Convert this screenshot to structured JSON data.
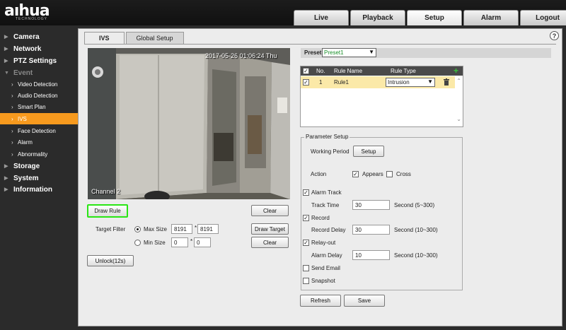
{
  "brand": {
    "name": "aıhua",
    "tagline": "TECHNOLOGY"
  },
  "topnav": [
    {
      "label": "Live"
    },
    {
      "label": "Playback"
    },
    {
      "label": "Setup",
      "active": true
    },
    {
      "label": "Alarm"
    },
    {
      "label": "Logout"
    }
  ],
  "sidebar": {
    "items": [
      {
        "label": "Camera",
        "level": "main",
        "icon": "chevron-right-icon"
      },
      {
        "label": "Network",
        "level": "main",
        "icon": "chevron-right-icon"
      },
      {
        "label": "PTZ Settings",
        "level": "main",
        "icon": "chevron-right-icon"
      },
      {
        "label": "Event",
        "level": "main",
        "icon": "chevron-down-icon",
        "open": true
      },
      {
        "label": "Video Detection",
        "level": "sub",
        "icon": "chevron-right-icon"
      },
      {
        "label": "Audio Detection",
        "level": "sub",
        "icon": "chevron-right-icon"
      },
      {
        "label": "Smart Plan",
        "level": "sub",
        "icon": "chevron-right-icon"
      },
      {
        "label": "IVS",
        "level": "sub",
        "icon": "chevron-right-icon",
        "selected": true
      },
      {
        "label": "Face Detection",
        "level": "sub",
        "icon": "chevron-right-icon"
      },
      {
        "label": "Alarm",
        "level": "sub",
        "icon": "chevron-right-icon"
      },
      {
        "label": "Abnormality",
        "level": "sub",
        "icon": "chevron-right-icon"
      },
      {
        "label": "Storage",
        "level": "main",
        "icon": "chevron-right-icon"
      },
      {
        "label": "System",
        "level": "main",
        "icon": "chevron-right-icon"
      },
      {
        "label": "Information",
        "level": "main",
        "icon": "chevron-right-icon"
      }
    ]
  },
  "content": {
    "help": "?",
    "tabs": [
      {
        "label": "IVS",
        "active": true
      },
      {
        "label": "Global Setup"
      }
    ],
    "video": {
      "timestamp": "2017-05-26 01:06:24 Thu",
      "channel": "Channel 2"
    },
    "left": {
      "draw_rule": "Draw Rule",
      "clear1": "Clear",
      "target_filter": "Target Filter",
      "max_size": "Max Size",
      "max_w": "8191",
      "max_sep": "*",
      "max_h": "8191",
      "draw_target": "Draw Target",
      "min_size": "Min Size",
      "min_w": "0",
      "min_sep": "*",
      "min_h": "0",
      "clear2": "Clear",
      "unlock": "Unlock(12s)"
    },
    "preset": {
      "label": "Preset",
      "value": "Preset1"
    },
    "rules": {
      "headers": {
        "no": "No.",
        "name": "Rule Name",
        "type": "Rule Type"
      },
      "add_icon": "plus-icon",
      "row": {
        "no": "1",
        "name": "Rule1",
        "type": "Intrusion",
        "delete_icon": "trash-icon"
      }
    },
    "params": {
      "legend": "Parameter Setup",
      "working_period": "Working Period",
      "setup": "Setup",
      "action": "Action",
      "appears": "Appears",
      "cross": "Cross",
      "alarm_track": "Alarm Track",
      "track_time": "Track Time",
      "track_time_value": "30",
      "track_time_unit": "Second (5~300)",
      "record": "Record",
      "record_delay": "Record Delay",
      "record_delay_value": "30",
      "record_delay_unit": "Second (10~300)",
      "relay_out": "Relay-out",
      "alarm_delay": "Alarm Delay",
      "alarm_delay_value": "10",
      "alarm_delay_unit": "Second (10~300)",
      "send_email": "Send Email",
      "snapshot": "Snapshot"
    },
    "refresh": "Refresh",
    "save": "Save",
    "checks": {
      "appears": true,
      "cross": false,
      "alarm_track": true,
      "record": true,
      "relay_out": true,
      "send_email": false,
      "snapshot": false
    }
  }
}
